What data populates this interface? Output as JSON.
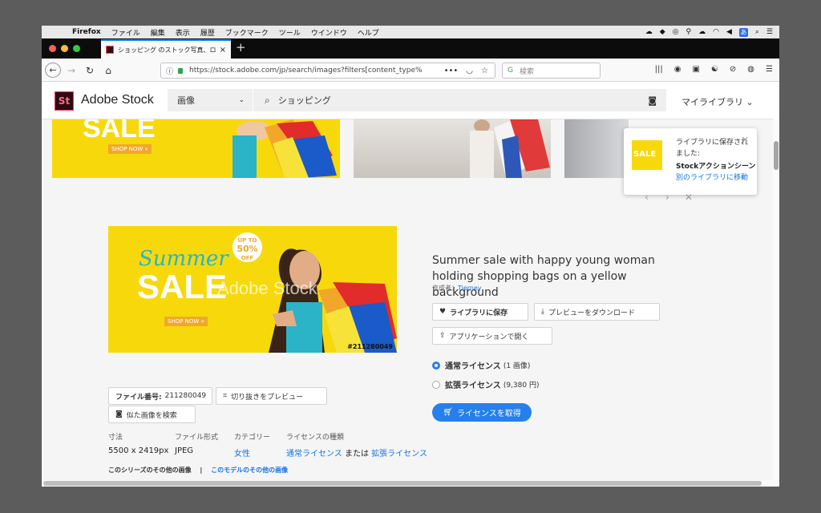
{
  "menubar": {
    "app_name": "Firefox",
    "items": [
      "ファイル",
      "編集",
      "表示",
      "履歴",
      "ブックマーク",
      "ツール",
      "ウインドウ",
      "ヘルプ"
    ],
    "ime_label": "あ"
  },
  "tab": {
    "title": "ショッピング のストック写真、ロ",
    "close": "×",
    "new_tab": "+"
  },
  "navbar": {
    "url": "https://stock.adobe.com/jp/search/images?filters[content_type%",
    "search_placeholder": "検索"
  },
  "stock_header": {
    "logo_text": "St",
    "brand": "Adobe Stock",
    "asset_type": "画像",
    "search_query": "ショッピング",
    "my_library": "マイライブラリ"
  },
  "thumbs": {
    "sale_text": "SALE",
    "shop_now": "SHOP NOW »"
  },
  "toast": {
    "message": "ライブラリに保存されました:",
    "library_name": "Stockアクションシーン",
    "move_link": "別のライブラリに移動"
  },
  "preview": {
    "badge_top": "UP TO",
    "badge_pct": "50%",
    "badge_off": "OFF",
    "summer": "Summer",
    "sale": "SALE",
    "shop_now": "SHOP NOW »",
    "watermark": "Adobe Stock",
    "image_id": "#211280049"
  },
  "file_info": {
    "file_number_label": "ファイル番号:",
    "file_number": "211280049",
    "crop_preview": "切り抜きをプレビュー",
    "find_similar": "似た画像を検索"
  },
  "details": {
    "dimensions_label": "寸法",
    "dimensions": "5500 x 2419px",
    "format_label": "ファイル形式",
    "format": "JPEG",
    "category_label": "カテゴリー",
    "category": "女性",
    "license_type_label": "ライセンスの種類",
    "license_standard": "通常ライセンス",
    "license_or": "または",
    "license_extended": "拡張ライセンス"
  },
  "series": {
    "series_link": "このシリーズのその他の画像",
    "separator": "|",
    "model_link": "このモデルのその他の画像"
  },
  "asset": {
    "title": "Summer sale with happy young woman holding shopping bags on a yellow background",
    "author_label": "作成者：",
    "author": "Tierney",
    "save_library": "ライブラリに保存",
    "download_preview": "プレビューをダウンロード",
    "open_in_app": "アプリケーションで開く",
    "standard_license": "通常ライセンス",
    "standard_detail": "(1 画像)",
    "extended_license": "拡張ライセンス",
    "extended_detail": "(9,380 円)",
    "get_license": "ライセンスを取得"
  }
}
